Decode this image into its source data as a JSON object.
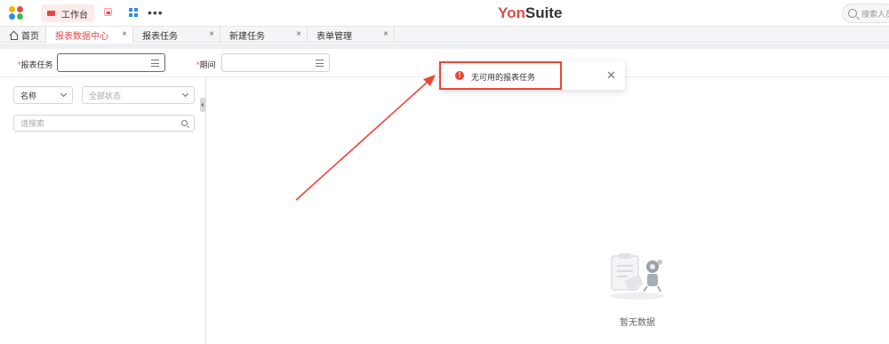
{
  "topbar": {
    "workbench_label": "工作台",
    "more": "•••",
    "brand_prefix": "Yon",
    "brand_suffix": "Suite",
    "search_placeholder": "搜索人员"
  },
  "tabs": [
    {
      "label": "首页",
      "active": false,
      "closable": false
    },
    {
      "label": "报表数据中心",
      "active": true,
      "closable": true
    },
    {
      "label": "报表任务",
      "active": false,
      "closable": true
    },
    {
      "label": "新建任务",
      "active": false,
      "closable": true
    },
    {
      "label": "表单管理",
      "active": false,
      "closable": true
    }
  ],
  "filters": {
    "task_label": "报表任务",
    "period_label": "期间",
    "required_mark": "*"
  },
  "left_panel": {
    "name_select": "名称",
    "status_select_placeholder": "全部状态",
    "search_placeholder": "请搜索"
  },
  "toast": {
    "message": "无可用的报表任务",
    "icon": "!",
    "close": "✕"
  },
  "empty_state": {
    "text": "暂无数据"
  },
  "colors": {
    "accent": "#e14c46",
    "annotation_red": "#f04438"
  }
}
